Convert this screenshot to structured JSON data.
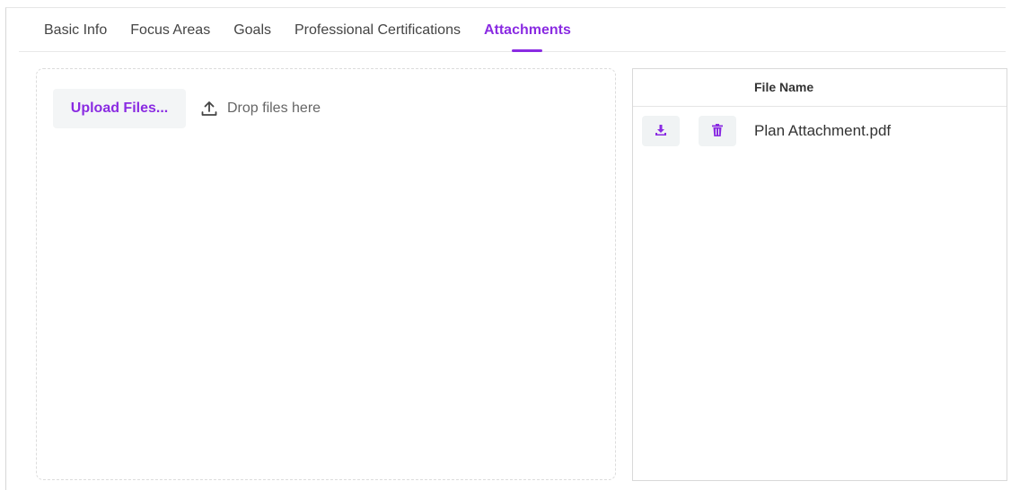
{
  "tabs": [
    {
      "label": "Basic Info",
      "active": false
    },
    {
      "label": "Focus Areas",
      "active": false
    },
    {
      "label": "Goals",
      "active": false
    },
    {
      "label": "Professional Certifications",
      "active": false
    },
    {
      "label": "Attachments",
      "active": true
    }
  ],
  "upload": {
    "button_label": "Upload Files...",
    "drop_hint": "Drop files here",
    "icon": "upload-icon"
  },
  "grid": {
    "columns": {
      "file_name": "File Name"
    },
    "rows": [
      {
        "file_name": "Plan Attachment.pdf",
        "actions": [
          "download-icon",
          "trash-icon"
        ]
      }
    ]
  },
  "colors": {
    "accent": "#8a2be2",
    "button_bg": "#f3f5f6",
    "border": "#d9d9d9"
  }
}
